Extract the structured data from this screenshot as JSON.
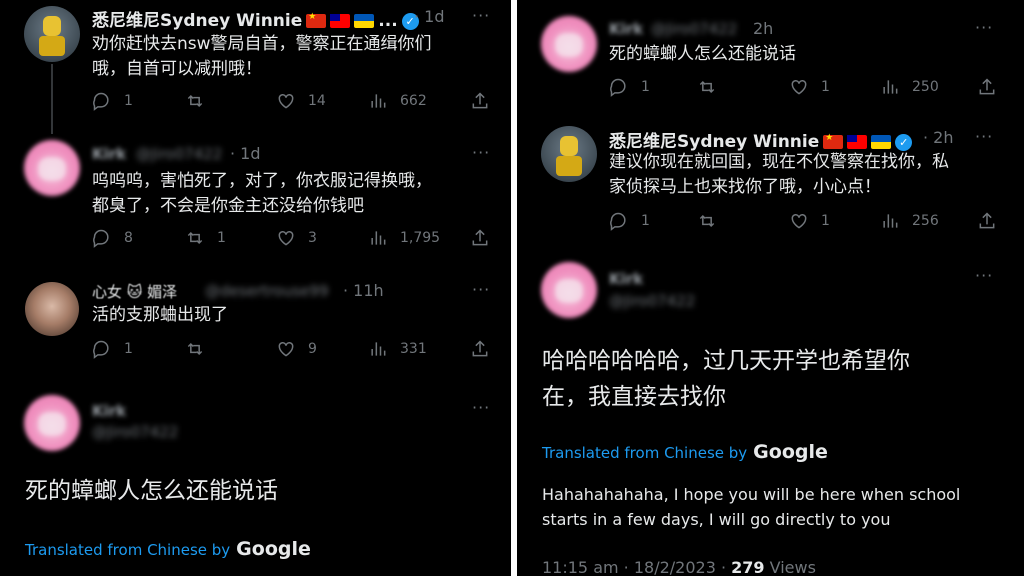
{
  "left": {
    "tweet1": {
      "name": "悉尼维尼Sydney Winnie",
      "ellipsis": "...",
      "time": "· 1d",
      "more": "···",
      "text_line1": "劝你赶快去nsw警局自首，警察正在通缉你们",
      "text_line2": "哦，自首可以减刑哦！",
      "replies": "1",
      "retweets": "",
      "likes": "14",
      "views": "662"
    },
    "tweet2": {
      "name": "Kirk",
      "handle": "@Jiro07422",
      "time": "· 1d",
      "more": "···",
      "text_line1": "呜呜呜，害怕死了，对了，你衣服记得换哦，",
      "text_line2": "都臭了，不会是你金主还没给你钱吧",
      "replies": "8",
      "retweets": "1",
      "likes": "3",
      "views": "1,795"
    },
    "tweet3": {
      "name": "心女 🐱 媚泽",
      "handle": "@desertrouse99",
      "time": "· 11h",
      "more": "···",
      "text_line1": "活的支那蛐出现了",
      "replies": "1",
      "retweets": "",
      "likes": "9",
      "views": "331"
    },
    "tweet4": {
      "name": "Kirk",
      "handle": "@Jiro07422",
      "more": "···",
      "text_line1": "死的蟑螂人怎么还能说话",
      "translated_by": "Translated from Chinese by",
      "google": "Google"
    }
  },
  "right": {
    "tweet1": {
      "name": "Kirk",
      "handle": "@Jiro07422",
      "time": "2h",
      "more": "···",
      "text_line1": "死的蟑螂人怎么还能说话",
      "replies": "1",
      "retweets": "",
      "likes": "1",
      "views": "250"
    },
    "tweet2": {
      "name": "悉尼维尼Sydney Winnie",
      "time": "· 2h",
      "more": "···",
      "text_line1": "建议你现在就回国，现在不仅警察在找你，私",
      "text_line2": "家侦探马上也来找你了哦，小心点！",
      "replies": "1",
      "retweets": "",
      "likes": "1",
      "views": "256"
    },
    "tweet3": {
      "name": "Kirk",
      "handle": "@Jiro07422",
      "more": "···",
      "text_line1": "哈哈哈哈哈哈，过几天开学也希望你",
      "text_line2": "在，我直接去找你",
      "translated_by": "Translated from Chinese by",
      "google": "Google",
      "translation_line1": "Hahahahahaha, I hope you will be here when school",
      "translation_line2": "starts in a few days, I will go directly to you",
      "timestamp": "11:15 am · 18/2/2023 · ",
      "view_count": "279",
      "views_label": " Views"
    }
  },
  "icons": {
    "reply": "reply-icon",
    "retweet": "retweet-icon",
    "like": "heart-icon",
    "views": "views-icon",
    "share": "share-icon",
    "verified": "verified-icon"
  },
  "colors": {
    "background": "#000000",
    "text": "#e7e9ea",
    "muted": "#71767b",
    "accent": "#1d9bf0"
  }
}
